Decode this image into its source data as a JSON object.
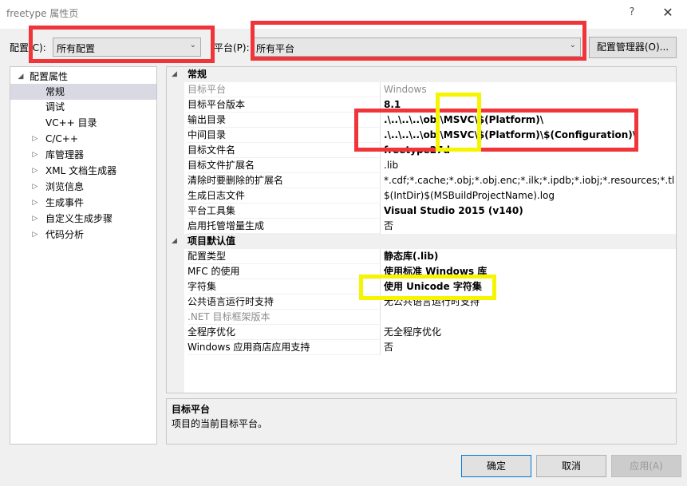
{
  "window": {
    "title": "freetype 属性页",
    "help": "?",
    "close": "✕"
  },
  "toolbar": {
    "config_label": "配置(C):",
    "config_value": "所有配置",
    "platform_label": "平台(P):",
    "platform_value": "所有平台",
    "config_manager": "配置管理器(O)..."
  },
  "tree": {
    "items": [
      {
        "label": "配置属性",
        "expander": "◢"
      },
      {
        "label": "常规"
      },
      {
        "label": "调试"
      },
      {
        "label": "VC++ 目录"
      },
      {
        "label": "C/C++",
        "expander": "▷"
      },
      {
        "label": "库管理器",
        "expander": "▷"
      },
      {
        "label": "XML 文档生成器",
        "expander": "▷"
      },
      {
        "label": "浏览信息",
        "expander": "▷"
      },
      {
        "label": "生成事件",
        "expander": "▷"
      },
      {
        "label": "自定义生成步骤",
        "expander": "▷"
      },
      {
        "label": "代码分析",
        "expander": "▷"
      }
    ]
  },
  "grid": {
    "cat1": {
      "label": "常规",
      "toggle": "◢"
    },
    "general": [
      {
        "name": "目标平台",
        "value": "Windows"
      },
      {
        "name": "目标平台版本",
        "value": "8.1"
      },
      {
        "name": "输出目录",
        "value": ".\\..\\..\\..\\obj\\MSVC\\$(Platform)\\"
      },
      {
        "name": "中间目录",
        "value": ".\\..\\..\\..\\obj\\MSVC\\$(Platform)\\$(Configuration)\\"
      },
      {
        "name": "目标文件名",
        "value": "freetype27d"
      },
      {
        "name": "目标文件扩展名",
        "value": ".lib"
      },
      {
        "name": "清除时要删除的扩展名",
        "value": "*.cdf;*.cache;*.obj;*.obj.enc;*.ilk;*.ipdb;*.iobj;*.resources;*.tlb;*.tli;*"
      },
      {
        "name": "生成日志文件",
        "value": "$(IntDir)$(MSBuildProjectName).log"
      },
      {
        "name": "平台工具集",
        "value": "Visual Studio 2015 (v140)"
      },
      {
        "name": "启用托管增量生成",
        "value": "否"
      }
    ],
    "cat2": {
      "label": "项目默认值",
      "toggle": "◢"
    },
    "defaults": [
      {
        "name": "配置类型",
        "value": "静态库(.lib)"
      },
      {
        "name": "MFC 的使用",
        "value": "使用标准 Windows 库"
      },
      {
        "name": "字符集",
        "value": "使用 Unicode 字符集"
      },
      {
        "name": "公共语言运行时支持",
        "value": "无公共语言运行时支持"
      },
      {
        "name": ".NET 目标框架版本",
        "value": ""
      },
      {
        "name": "全程序优化",
        "value": "无全程序优化"
      },
      {
        "name": "Windows 应用商店应用支持",
        "value": "否"
      }
    ]
  },
  "description": {
    "title": "目标平台",
    "text": "项目的当前目标平台。"
  },
  "buttons": {
    "ok": "确定",
    "cancel": "取消",
    "apply": "应用(A)"
  }
}
